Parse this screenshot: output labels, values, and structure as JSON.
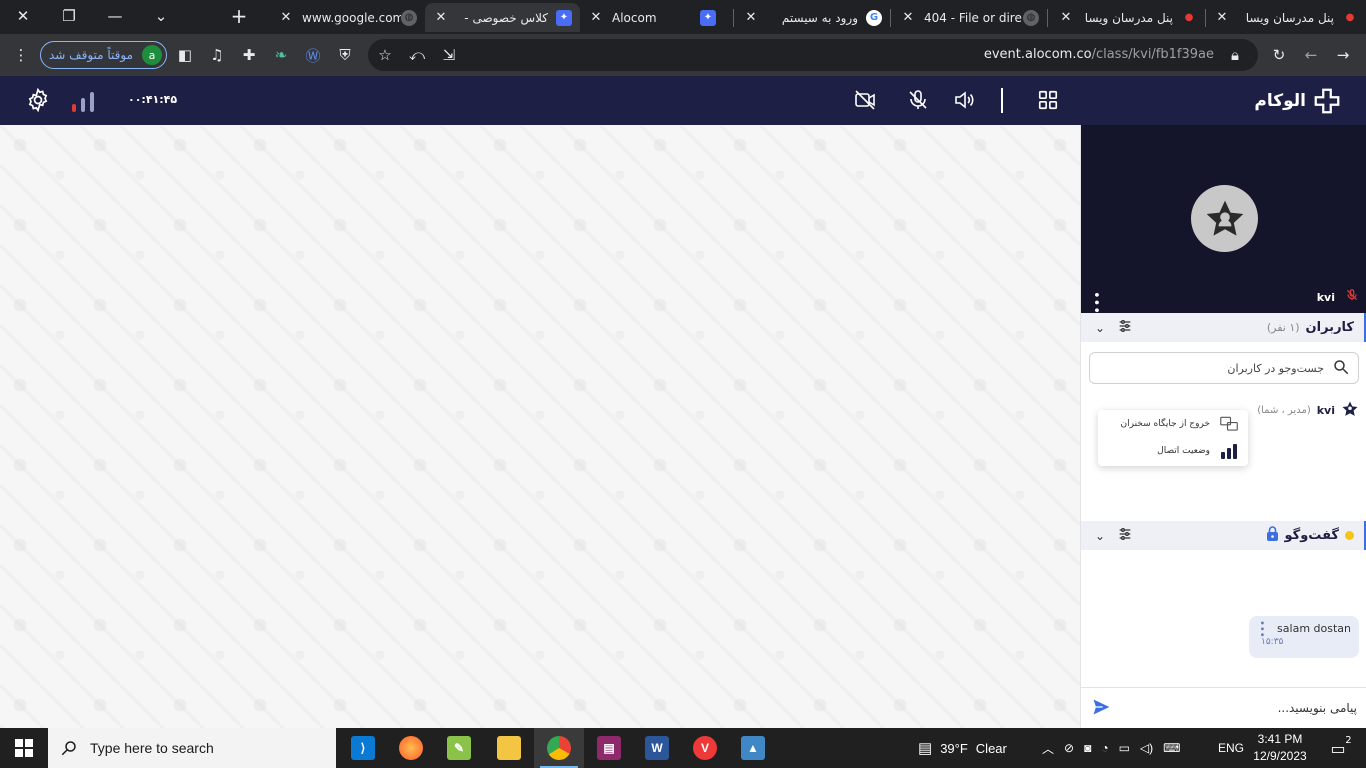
{
  "browser": {
    "tabs": [
      {
        "title": "پنل مدرسان ویسا",
        "favicon": "red-brain-icon"
      },
      {
        "title": "پنل مدرسان ویسا",
        "favicon": "red-brain-icon"
      },
      {
        "title": "404 - File or dire",
        "favicon": "globe-icon"
      },
      {
        "title": "ورود به سیستم",
        "favicon": "google-icon"
      },
      {
        "title": "- ",
        "favicon": "alocom-icon"
      },
      {
        "title": "Alocom",
        "favicon": "alocom-icon"
      },
      {
        "title": "کلاس خصوصی -",
        "favicon": "alocom-icon",
        "active": true
      },
      {
        "title": "www.google.com",
        "favicon": "globe-icon"
      }
    ],
    "new_tab_label": "+",
    "profile": {
      "status": "موقتاً متوقف شد",
      "initial": "a"
    },
    "url": {
      "domain": "event.alocom.co",
      "path": "/class/kvi/fb1f39ae"
    }
  },
  "header": {
    "brand": "الوکام",
    "timer": "۰۰:۴۱:۴۵",
    "signal_level": 0.33,
    "colors": {
      "bg": "#1e1f44",
      "signal_low": "#e53935"
    }
  },
  "panel": {
    "video": {
      "name": "kvi"
    },
    "users": {
      "title": "کاربران",
      "count": "(۱ نفر)",
      "search_placeholder": "جست‌وجو در کاربران",
      "list": [
        {
          "name": "kvi",
          "role": "(مدیر ، شما)"
        }
      ],
      "context_menu": [
        "خروج از جایگاه سخنران",
        "وضعیت اتصال"
      ]
    },
    "chat": {
      "title": "گفت‌وگو",
      "messages": [
        {
          "text": "salam dostan",
          "time": "۱۵:۳۵"
        }
      ],
      "input_placeholder": "پیامی بنویسید..."
    }
  },
  "taskbar": {
    "search_placeholder": "Type here to search",
    "weather": {
      "temp": "39°F",
      "cond": "Clear"
    },
    "lang": "ENG",
    "time": "3:41 PM",
    "date": "12/9/2023",
    "notifications": "2"
  }
}
